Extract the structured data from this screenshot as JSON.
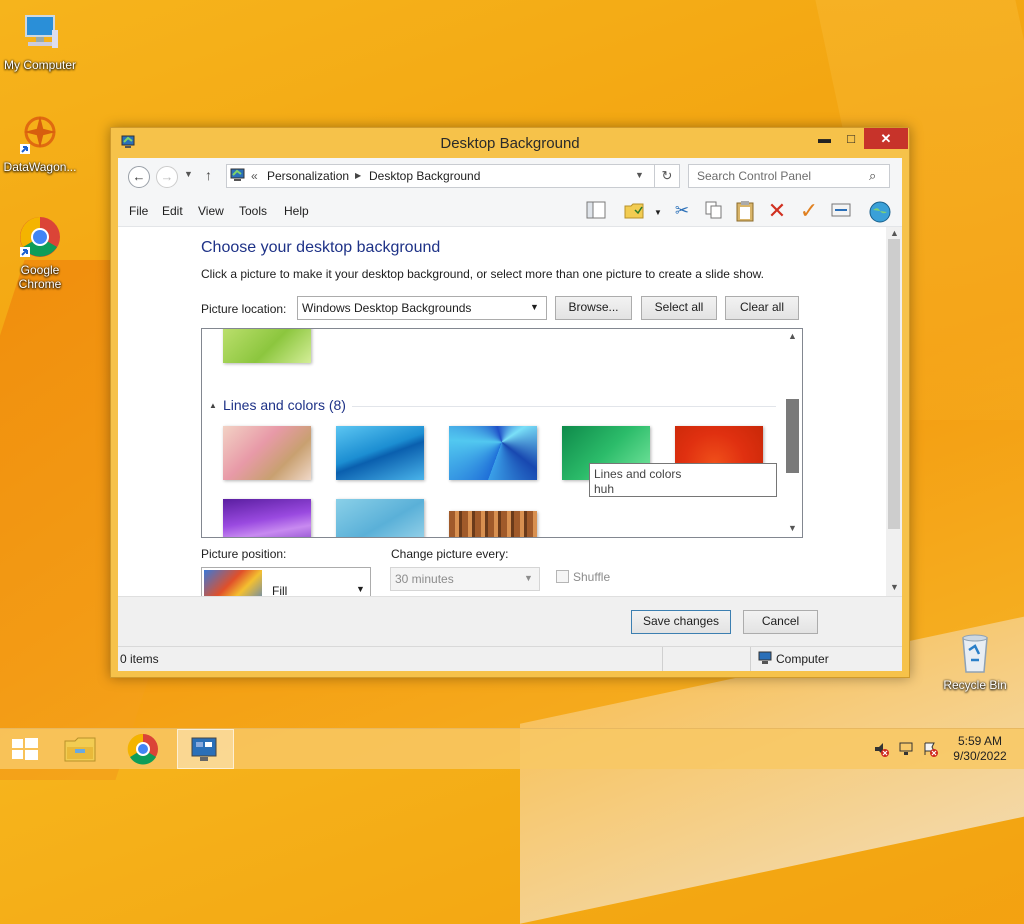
{
  "desktop": {
    "icons": [
      {
        "label": "My Computer"
      },
      {
        "label": "DataWagon..."
      },
      {
        "label": "Google Chrome"
      },
      {
        "label": "Recycle Bin"
      }
    ]
  },
  "window": {
    "title": "Desktop Background",
    "caption": {
      "minimize": "▬",
      "maximize": "□",
      "close": "✕"
    },
    "address": {
      "prefix": "«",
      "crumbs": [
        "Personalization",
        "Desktop Background"
      ]
    },
    "search_placeholder": "Search Control Panel",
    "menu": [
      "File",
      "Edit",
      "View",
      "Tools",
      "Help"
    ],
    "heading": "Choose your desktop background",
    "subheading": "Click a picture to make it your desktop background, or select more than one picture to create a slide show.",
    "picture_location_label": "Picture location:",
    "picture_location_value": "Windows Desktop Backgrounds",
    "buttons": {
      "browse": "Browse...",
      "select_all": "Select all",
      "clear_all": "Clear all",
      "save": "Save changes",
      "cancel": "Cancel"
    },
    "group": {
      "title": "Lines and colors (8)"
    },
    "tooltip": {
      "line1": "Lines and colors",
      "line2": "huh"
    },
    "picture_position_label": "Picture position:",
    "picture_position_value": "Fill",
    "change_every_label": "Change picture every:",
    "change_every_value": "30 minutes",
    "shuffle_label": "Shuffle",
    "status_items": "0 items",
    "status_location": "Computer"
  },
  "taskbar": {
    "time": "5:59 AM",
    "date": "9/30/2022"
  }
}
